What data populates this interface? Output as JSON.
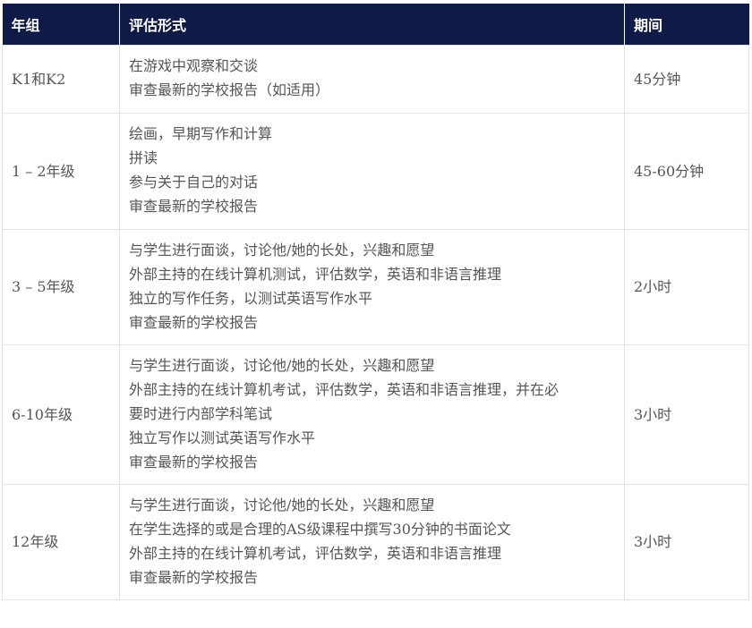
{
  "headers": {
    "grade": "年组",
    "format": "评估形式",
    "duration": "期间"
  },
  "rows": [
    {
      "grade": "K1和K2",
      "items": [
        "在游戏中观察和交谈",
        "审查最新的学校报告（如适用）"
      ],
      "duration": "45分钟"
    },
    {
      "grade": "1 – 2年级",
      "items": [
        "绘画，早期写作和计算",
        "拼读",
        "参与关于自己的对话",
        "审查最新的学校报告"
      ],
      "duration": "45-60分钟"
    },
    {
      "grade": "3 – 5年级",
      "items": [
        "与学生进行面谈，讨论他/她的长处，兴趣和愿望",
        "外部主持的在线计算机测试，评估数学，英语和非语言推理",
        "独立的写作任务，以测试英语写作水平",
        "审查最新的学校报告"
      ],
      "duration": "2小时"
    },
    {
      "grade": "6-10年级",
      "items": [
        "与学生进行面谈，讨论他/她的长处，兴趣和愿望",
        "外部主持的在线计算机考试，评估数学，英语和非语言推理，并在必",
        "要时进行内部学科笔试",
        "独立写作以测试英语写作水平",
        "审查最新的学校报告"
      ],
      "duration": "3小时"
    },
    {
      "grade": "12年级",
      "items": [
        "与学生进行面谈，讨论他/她的长处，兴趣和愿望",
        "在学生选择的或是合理的AS级课程中撰写30分钟的书面论文",
        "外部主持的在线计算机考试，评估数学，英语和非语言推理",
        "审查最新的学校报告"
      ],
      "duration": "3小时"
    }
  ],
  "colors": {
    "header_bg": "#0f1a47",
    "header_text": "#ffffff",
    "body_text": "#555555",
    "border": "#e3e3e3"
  }
}
